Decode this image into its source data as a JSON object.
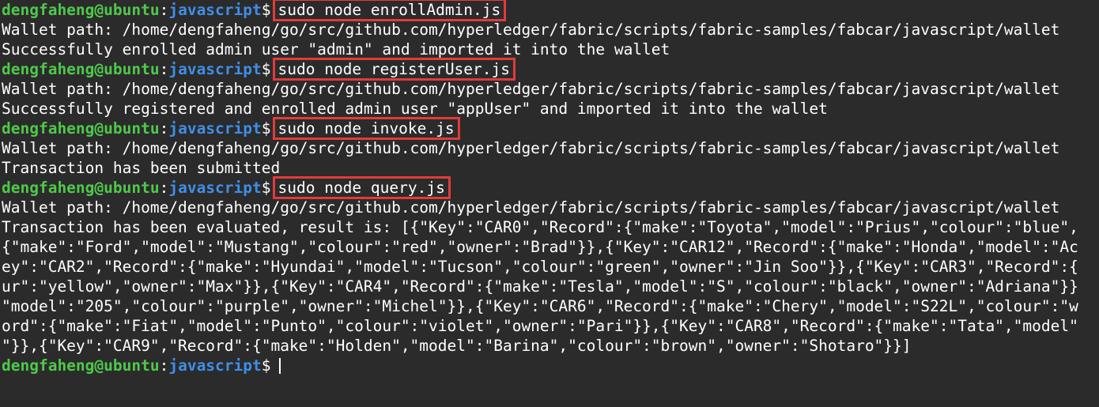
{
  "prompt": {
    "user_host": "dengfaheng@ubuntu",
    "colon": ":",
    "directory": "javascript",
    "symbol": "$"
  },
  "blocks": [
    {
      "command": "sudo node enrollAdmin.js",
      "output": [
        "Wallet path: /home/dengfaheng/go/src/github.com/hyperledger/fabric/scripts/fabric-samples/fabcar/javascript/wallet",
        "Successfully enrolled admin user \"admin\" and imported it into the wallet"
      ]
    },
    {
      "command": "sudo node registerUser.js",
      "output": [
        "Wallet path: /home/dengfaheng/go/src/github.com/hyperledger/fabric/scripts/fabric-samples/fabcar/javascript/wallet",
        "Successfully registered and enrolled admin user \"appUser\" and imported it into the wallet"
      ]
    },
    {
      "command": "sudo node invoke.js",
      "output": [
        "Wallet path: /home/dengfaheng/go/src/github.com/hyperledger/fabric/scripts/fabric-samples/fabcar/javascript/wallet",
        "Transaction has been submitted"
      ]
    },
    {
      "command": "sudo node query.js",
      "output": [
        "Wallet path: /home/dengfaheng/go/src/github.com/hyperledger/fabric/scripts/fabric-samples/fabcar/javascript/wallet",
        "Transaction has been evaluated, result is: [{\"Key\":\"CAR0\",\"Record\":{\"make\":\"Toyota\",\"model\":\"Prius\",\"colour\":\"blue\",",
        "{\"make\":\"Ford\",\"model\":\"Mustang\",\"colour\":\"red\",\"owner\":\"Brad\"}},{\"Key\":\"CAR12\",\"Record\":{\"make\":\"Honda\",\"model\":\"Ac",
        "ey\":\"CAR2\",\"Record\":{\"make\":\"Hyundai\",\"model\":\"Tucson\",\"colour\":\"green\",\"owner\":\"Jin Soo\"}},{\"Key\":\"CAR3\",\"Record\":{",
        "ur\":\"yellow\",\"owner\":\"Max\"}},{\"Key\":\"CAR4\",\"Record\":{\"make\":\"Tesla\",\"model\":\"S\",\"colour\":\"black\",\"owner\":\"Adriana\"}}",
        "\"model\":\"205\",\"colour\":\"purple\",\"owner\":\"Michel\"}},{\"Key\":\"CAR6\",\"Record\":{\"make\":\"Chery\",\"model\":\"S22L\",\"colour\":\"w",
        "ord\":{\"make\":\"Fiat\",\"model\":\"Punto\",\"colour\":\"violet\",\"owner\":\"Pari\"}},{\"Key\":\"CAR8\",\"Record\":{\"make\":\"Tata\",\"model\"",
        "\"}},{\"Key\":\"CAR9\",\"Record\":{\"make\":\"Holden\",\"model\":\"Barina\",\"colour\":\"brown\",\"owner\":\"Shotaro\"}}]"
      ]
    }
  ],
  "colors": {
    "background": "#2b2b2b",
    "prompt_user": "#4ec94a",
    "prompt_directory": "#3f8ee8",
    "text": "#ffffff",
    "highlight_box": "#e23b3b"
  }
}
